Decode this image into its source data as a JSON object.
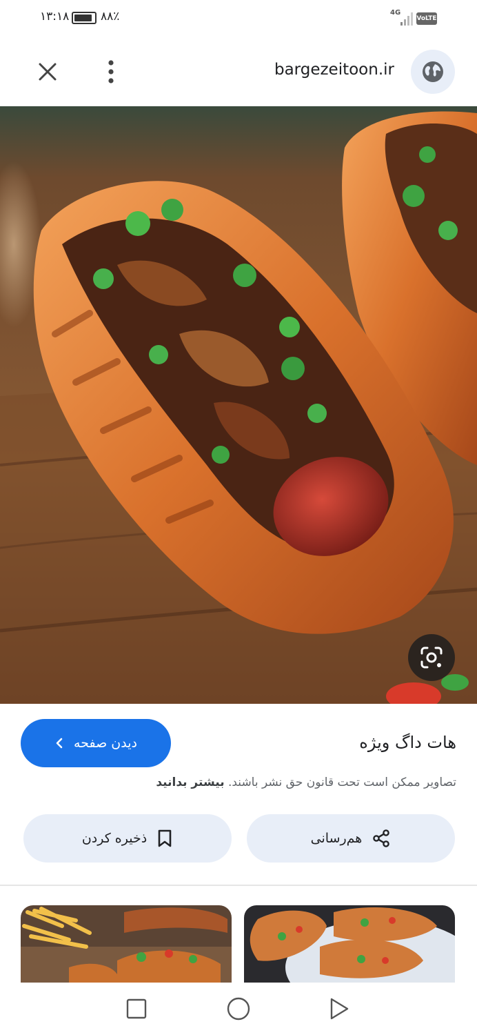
{
  "status_bar": {
    "time": "۱۳:۱۸",
    "battery_percent": "۸۸٪",
    "battery_level": 0.88,
    "network": "4G",
    "volte": "VoLTE"
  },
  "topbar": {
    "domain": "bargezeitoon.ir"
  },
  "result": {
    "title": "هات داگ ویژه",
    "visit_label": "دیدن صفحه",
    "copyright_text": "تصاویر ممکن است تحت قانون حق نشر باشند.",
    "learn_more": "بیشتر بدانید",
    "share_label": "هم‌رسانی",
    "save_label": "ذخیره کردن"
  },
  "icons": {
    "close": "close-icon",
    "menu": "more-vert-icon",
    "globe": "globe-icon",
    "lens": "lens-icon",
    "share": "share-icon",
    "bookmark": "bookmark-icon"
  },
  "colors": {
    "accent": "#1a73e8",
    "chip_bg": "#e8eef8"
  }
}
